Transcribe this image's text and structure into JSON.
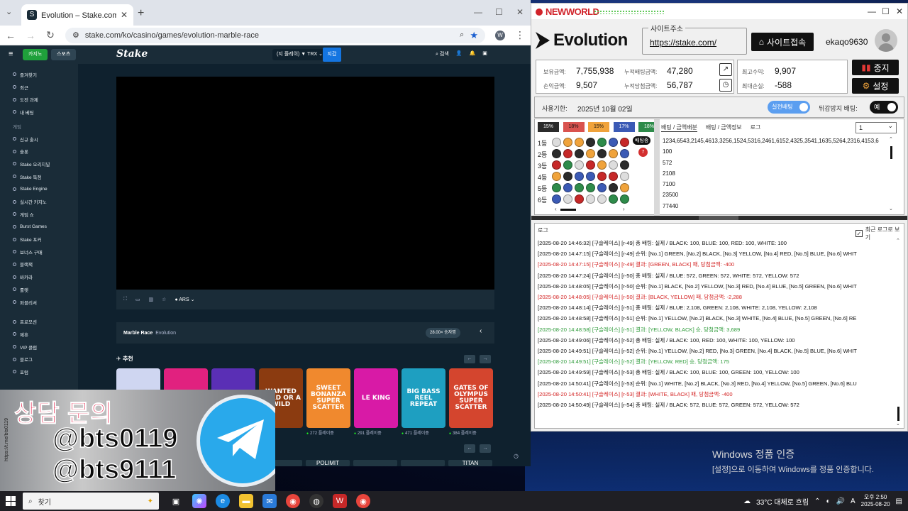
{
  "desktop": {
    "activation_title": "Windows 정품 인증",
    "activation_sub": "[설정]으로 이동하여 Windows를 정품 인증합니다."
  },
  "chrome": {
    "tab_title": "Evolution – Stake.com에서 제공",
    "url": "stake.com/ko/casino/games/evolution-marble-race",
    "profile_initial": "W"
  },
  "stake": {
    "nav_casino": "카지노",
    "nav_sports": "스포츠",
    "logo": "Stake",
    "wallet": "(지 플레이) ▼ TRX ⌄",
    "deposit": "지갑",
    "search": "검색",
    "sidebar": [
      "즐겨찾기",
      "최근",
      "도전 과제",
      "내 베팅"
    ],
    "sidebar_section": "게임",
    "sidebar_games": [
      "신규 출시",
      "슬롯",
      "Stake 오리지널",
      "Stake 독점",
      "Stake Engine",
      "실시간 카지노",
      "게임 쇼",
      "Burst Games",
      "Stake 포커",
      "보너스 구매",
      "블랙잭",
      "바카라",
      "룰렛",
      "퍼블리셔"
    ],
    "sidebar_more": [
      "프로모션",
      "제휴",
      "VIP 클럽",
      "블로그",
      "포럼"
    ],
    "ars": "ARS",
    "game_name": "Marble Race",
    "game_provider": "Evolution",
    "game_badge": "28.00× 승자명",
    "recommended": "추천",
    "cards": [
      {
        "name": "",
        "color": "#cfd6f1",
        "count": ""
      },
      {
        "name": "",
        "color": "#e1217f",
        "count": ""
      },
      {
        "name": "",
        "color": "#5a2fb5",
        "count": ""
      },
      {
        "name": "WANTED DEAD OR A WILD",
        "color": "#8b3b10",
        "count": "..."
      },
      {
        "name": "SWEET BONANZA SUPER SCATTER",
        "color": "#f0892e",
        "count": "272 플레이중"
      },
      {
        "name": "LE KING",
        "color": "#d81aa6",
        "count": "291 플레이중"
      },
      {
        "name": "BIG BASS REEL REPEAT",
        "color": "#1e9fc1",
        "count": "471 플레이중"
      },
      {
        "name": "GATES OF OLYMPUS SUPER SCATTER",
        "color": "#d4452e",
        "count": "384 플레이중"
      }
    ],
    "providers": [
      "",
      "POLIMIT",
      "",
      "",
      "TITAN"
    ]
  },
  "promo": {
    "title": "상담 문의",
    "id1": "@bts0119",
    "id2": "@bts9111",
    "side_url": "https://t.me/bts0119"
  },
  "taskbar": {
    "search_placeholder": "찾기",
    "weather": "33°C 대체로 흐림",
    "time": "오후 2:50",
    "date": "2025-08-20",
    "ime": "A"
  },
  "nw": {
    "app_name": "NEWWORLD",
    "brand": "Evolution",
    "site_label": "사이트주소",
    "site_url": "https://stake.com/",
    "site_button": "사이트접속",
    "user_id": "ekaqo9630",
    "stats": {
      "balance_label": "보유금액:",
      "balance": "7,755,938",
      "profit_label": "손익금액:",
      "profit": "9,507",
      "total_bet_label": "누적배팅금액:",
      "total_bet": "47,280",
      "total_win_label": "누적당첨금액:",
      "total_win": "56,787",
      "max_profit_label": "최고수익:",
      "max_profit": "9,907",
      "max_loss_label": "최대손실:",
      "max_loss": "-588"
    },
    "stop_button": "중지",
    "settings_button": "설정",
    "expiry_label": "사용기한:",
    "expiry_date": "2025년 10월 02일",
    "real_bet_toggle": "실전배팅",
    "anti_track_label": "뒤감방지 배팅:",
    "anti_track_value": "예",
    "percentages": [
      {
        "label": "15%",
        "color": "#2b2b2b",
        "text": "#fff"
      },
      {
        "label": "18%",
        "color": "#d9534f",
        "text": "#111"
      },
      {
        "label": "15%",
        "color": "#f0a33b",
        "text": "#111"
      },
      {
        "label": "17%",
        "color": "#3b5ab5",
        "text": "#fff"
      },
      {
        "label": "18%",
        "color": "#2e8b4a",
        "text": "#fff"
      }
    ],
    "row_labels": [
      "1등",
      "2등",
      "3등",
      "4등",
      "5등",
      "6등"
    ],
    "ball_rows": [
      [
        "#ddd",
        "#f0a33b",
        "#f0a33b",
        "#2b2b2b",
        "#2e8b4a",
        "#3b5ab5",
        "#c62828"
      ],
      [
        "#2b2b2b",
        "#c62828",
        "#2b2b2b",
        "#f0a33b",
        "#2b2b2b",
        "#f0a33b",
        "#3b5ab5"
      ],
      [
        "#c62828",
        "#2e8b4a",
        "#ddd",
        "#c62828",
        "#f0a33b",
        "#ddd",
        "#2b2b2b"
      ],
      [
        "#f0a33b",
        "#2b2b2b",
        "#3b5ab5",
        "#3b5ab5",
        "#c62828",
        "#c62828",
        "#ddd"
      ],
      [
        "#2e8b4a",
        "#3b5ab5",
        "#2e8b4a",
        "#2e8b4a",
        "#3b5ab5",
        "#2b2b2b",
        "#f0a33b"
      ],
      [
        "#3b5ab5",
        "#ddd",
        "#c62828",
        "#ddd",
        "#ddd",
        "#2e8b4a",
        "#2e8b4a"
      ]
    ],
    "in_bet_badge": "배팅중",
    "round_badge": "7",
    "tabs": [
      "배팅 / 금액배분",
      "배팅 / 금액정보",
      "로그"
    ],
    "select_value": "1",
    "numbers": [
      "1234,6543,2145,4613,3256,1524,5316,2461,6152,4325,3541,1635,5264,2316,4153,6",
      "100",
      "572",
      "2108",
      "7100",
      "23500",
      "77440"
    ],
    "log_header": "로그",
    "log_checkbox": "최근 로그로 보기",
    "logs": [
      {
        "c": "black",
        "t": "[2025-08-20 14:46:32] [구슬레이스] [r-49] 총 배팅: 실제  / BLACK: 100, BLUE: 100, RED: 100, WHITE: 100"
      },
      {
        "c": "black",
        "t": "[2025-08-20 14:47:15] [구슬레이스] [r-49] 순위: [No.1] GREEN, [No.2] BLACK, [No.3] YELLOW, [No.4] RED, [No.5] BLUE, [No.6] WHIT"
      },
      {
        "c": "red",
        "t": "[2025-08-20 14:47:15] [구슬레이스] [r-49] 결과: [GREEN, BLACK] 패, 당첨금액: -400"
      },
      {
        "c": "black",
        "t": "[2025-08-20 14:47:24] [구슬레이스] [r-50] 총 배팅: 실제  / BLUE: 572, GREEN: 572, WHITE: 572, YELLOW: 572"
      },
      {
        "c": "black",
        "t": "[2025-08-20 14:48:05] [구슬레이스] [r-50] 순위: [No.1] BLACK, [No.2] YELLOW, [No.3] RED, [No.4] BLUE, [No.5] GREEN, [No.6] WHIT"
      },
      {
        "c": "red",
        "t": "[2025-08-20 14:48:05] [구슬레이스] [r-50] 결과: [BLACK, YELLOW] 패, 당첨금액: -2,288"
      },
      {
        "c": "black",
        "t": "[2025-08-20 14:48:14] [구슬레이스] [r-51] 총 배팅: 실제  / BLUE: 2,108, GREEN: 2,108, WHITE: 2,108, YELLOW: 2,108"
      },
      {
        "c": "black",
        "t": "[2025-08-20 14:48:58] [구슬레이스] [r-51] 순위: [No.1] YELLOW, [No.2] BLACK, [No.3] WHITE, [No.4] BLUE, [No.5] GREEN, [No.6] RE"
      },
      {
        "c": "green",
        "t": "[2025-08-20 14:48:58] [구슬레이스] [r-51] 결과: [YELLOW, BLACK] 승, 당첨금액: 3,689"
      },
      {
        "c": "black",
        "t": "[2025-08-20 14:49:06] [구슬레이스] [r-52] 총 배팅: 실제  / BLACK: 100, RED: 100, WHITE: 100, YELLOW: 100"
      },
      {
        "c": "black",
        "t": "[2025-08-20 14:49:51] [구슬레이스] [r-52] 순위: [No.1] YELLOW, [No.2] RED, [No.3] GREEN, [No.4] BLACK, [No.5] BLUE, [No.6] WHIT"
      },
      {
        "c": "green",
        "t": "[2025-08-20 14:49:51] [구슬레이스] [r-52] 결과: [YELLOW, RED] 승, 당첨금액: 175"
      },
      {
        "c": "black",
        "t": "[2025-08-20 14:49:59] [구슬레이스] [r-53] 총 배팅: 실제  / BLACK: 100, BLUE: 100, GREEN: 100, YELLOW: 100"
      },
      {
        "c": "black",
        "t": "[2025-08-20 14:50:41] [구슬레이스] [r-53] 순위: [No.1] WHITE, [No.2] BLACK, [No.3] RED, [No.4] YELLOW, [No.5] GREEN, [No.6] BLU"
      },
      {
        "c": "red",
        "t": "[2025-08-20 14:50:41] [구슬레이스] [r-53] 결과: [WHITE, BLACK] 패, 당첨금액: -400"
      },
      {
        "c": "black",
        "t": "[2025-08-20 14:50:49] [구슬레이스] [r-54] 총 배팅: 실제  / BLACK: 572, BLUE: 572, GREEN: 572, YELLOW: 572"
      }
    ]
  }
}
